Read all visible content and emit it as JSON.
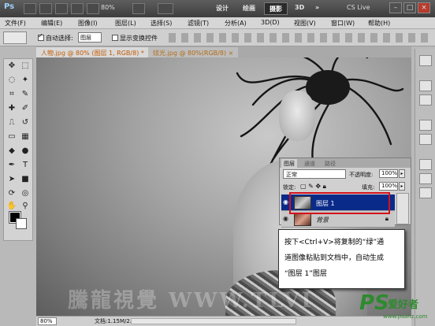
{
  "titlebar": {
    "logo": "Ps",
    "zoom": "80%",
    "workspaces": [
      "设计",
      "绘画",
      "摄影",
      "3D"
    ],
    "active_workspace": "摄影",
    "more": "»",
    "cs_live": "CS Live",
    "minimize": "–",
    "maximize": "□",
    "close": "×"
  },
  "menu": [
    "文件(F)",
    "编辑(E)",
    "图像(I)",
    "图层(L)",
    "选择(S)",
    "滤镜(T)",
    "分析(A)",
    "3D(D)",
    "视图(V)",
    "窗口(W)",
    "帮助(H)"
  ],
  "options": {
    "auto_select_label": "自动选择:",
    "auto_select_value": "图层",
    "show_transform_label": "显示变换控件"
  },
  "tabs": [
    {
      "label": "人物.jpg @ 80% (图层 1, RGB/8) *",
      "active": true
    },
    {
      "label": "炫光.jpg @ 80%(RGB/8) ×",
      "active": false
    }
  ],
  "canvas": {
    "watermark": "騰龍視覺 WWW.TLVI"
  },
  "status": {
    "zoom": "80%",
    "doc": "文档:1.15M/2.31M"
  },
  "layers_panel": {
    "tabs": [
      "图层",
      "通道",
      "路径"
    ],
    "active_tab": "图层",
    "blend_mode": "正常",
    "opacity_label": "不透明度:",
    "opacity_value": "100%",
    "lock_label": "锁定:",
    "fill_label": "填充:",
    "fill_value": "100%",
    "layers": [
      {
        "name": "图层 1",
        "selected": true
      },
      {
        "name": "背景",
        "selected": false
      }
    ]
  },
  "callout": {
    "line1": "按下<Ctrl+V>将复制的“绿”通",
    "line2": "道图像粘贴到文档中，自动生成",
    "line3": "“图层 1”图层"
  },
  "site_logo": {
    "ps": "PS",
    "cn": "爱好者",
    "url": "www.psahz.com"
  },
  "colors": {
    "selected_layer": "#0a2a8a",
    "highlight_box": "#d3121b",
    "logo_green": "#2e8a2e"
  }
}
